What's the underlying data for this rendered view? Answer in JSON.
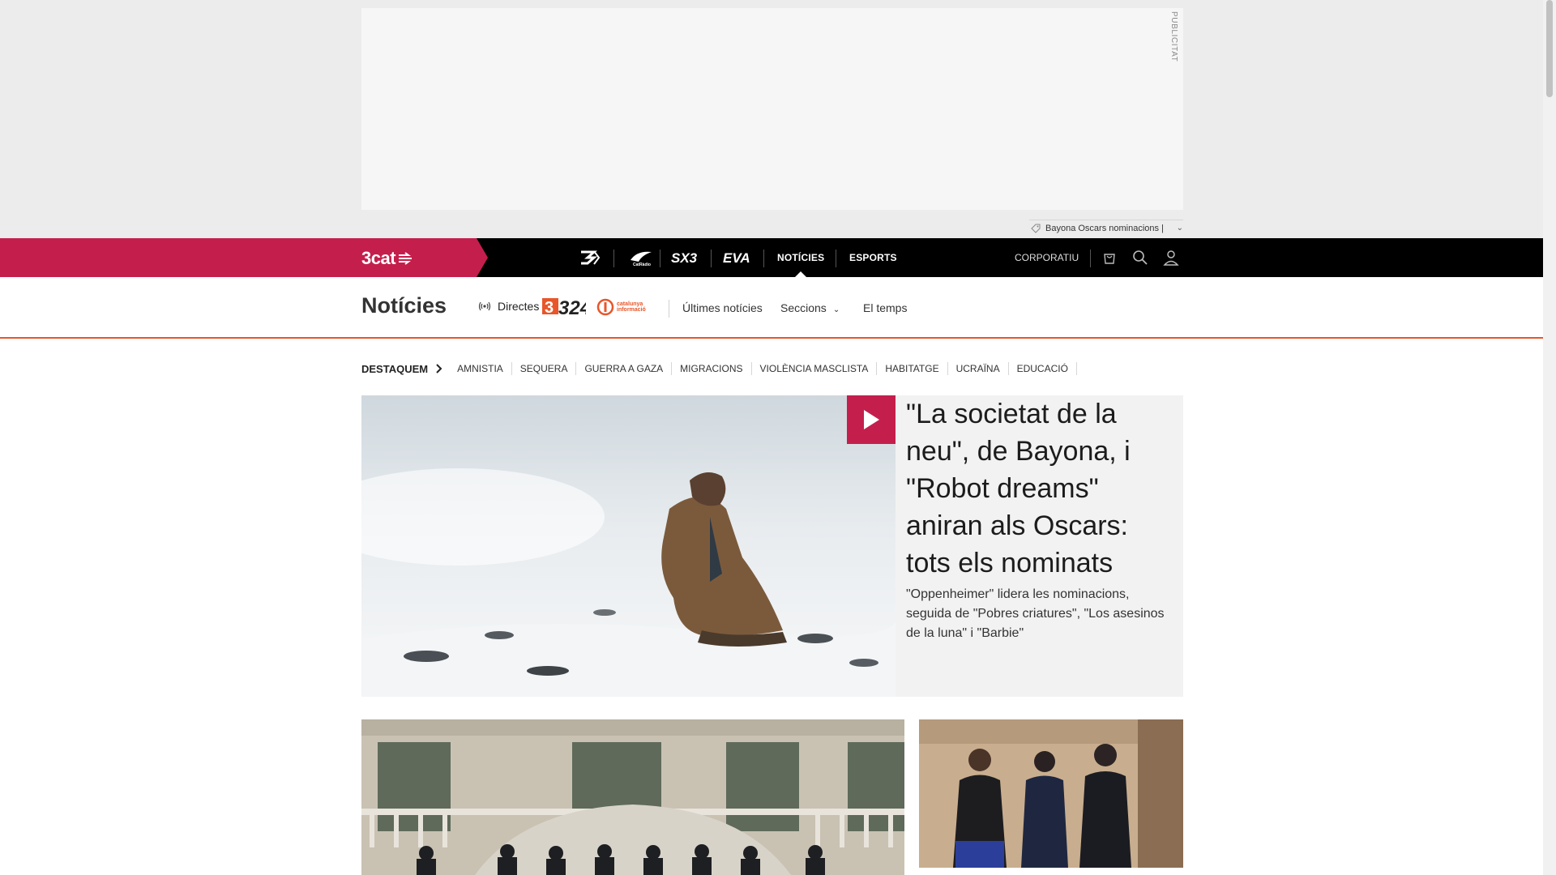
{
  "ad": {
    "label": "PUBLICITAT",
    "trend_text": "Bayona Oscars nominacions |"
  },
  "nav": {
    "logo_text": "3cat",
    "channels": [
      {
        "name": "3-icon"
      },
      {
        "name": "catradio-icon",
        "label": "CatRàdio"
      },
      {
        "name": "sx3-icon",
        "label": "SX3"
      },
      {
        "name": "eva-icon",
        "label": "EVA"
      }
    ],
    "noticies": "NOTÍCIES",
    "esports": "ESPORTS",
    "corporatiu": "CORPORATIU"
  },
  "section": {
    "title": "Notícies",
    "directes": "Directes",
    "logo_324": "324",
    "logo_ci_line1": "catalunya",
    "logo_ci_line2": "informació",
    "links": {
      "ultimes": "Últimes notícies",
      "seccions": "Seccions",
      "temps": "El temps"
    }
  },
  "destaquem": {
    "lead": "DESTAQUEM",
    "topics": [
      "AMNISTIA",
      "SEQUERA",
      "GUERRA A GAZA",
      "MIGRACIONS",
      "VIOLÈNCIA MASCLISTA",
      "HABITATGE",
      "UCRAÏNA",
      "EDUCACIÓ"
    ]
  },
  "hero": {
    "title": "\"La societat de la neu\", de Bayona, i \"Robot dreams\" aniran als Oscars: tots els nominats",
    "subtitle": "\"Oppenheimer\" lidera les nominacions, seguida de \"Pobres criatures\", \"Los asesinos de la luna\" i \"Barbie\""
  },
  "colors": {
    "brand": "#c41f4c",
    "accent": "#e8562a",
    "nav_bg": "#000000"
  }
}
